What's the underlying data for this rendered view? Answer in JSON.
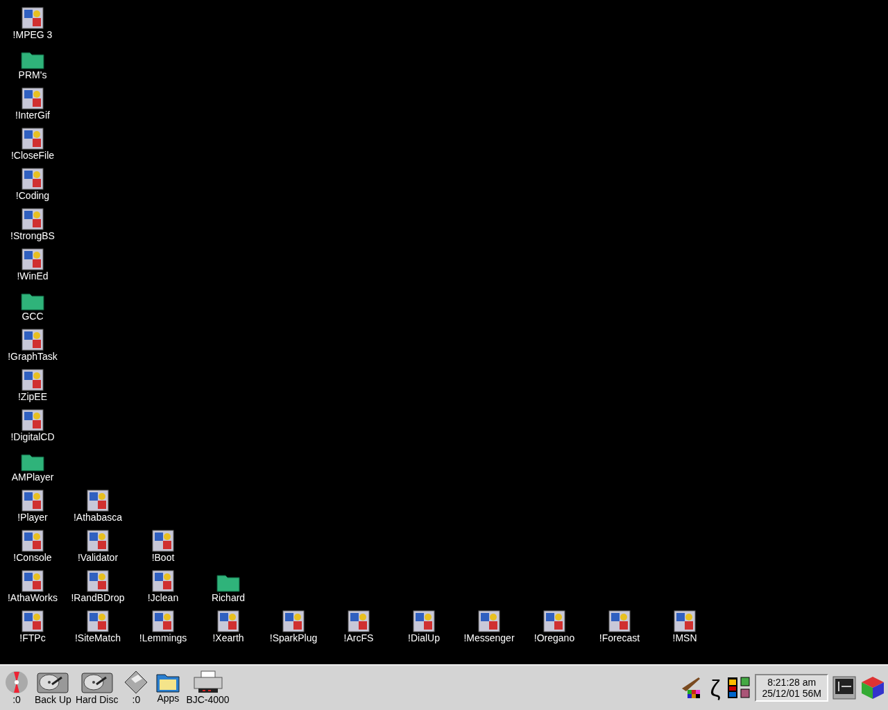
{
  "desktop": {
    "columns": [
      [
        {
          "label": "!MPEG 3",
          "kind": "app"
        },
        {
          "label": "PRM's",
          "kind": "folder"
        },
        {
          "label": "!InterGif",
          "kind": "app"
        },
        {
          "label": "!CloseFile",
          "kind": "app"
        },
        {
          "label": "!Coding",
          "kind": "app"
        },
        {
          "label": "!StrongBS",
          "kind": "app"
        },
        {
          "label": "!WinEd",
          "kind": "app"
        },
        {
          "label": "GCC",
          "kind": "folder"
        },
        {
          "label": "!GraphTask",
          "kind": "app"
        },
        {
          "label": "!ZipEE",
          "kind": "app"
        },
        {
          "label": "!DigitalCD",
          "kind": "app"
        },
        {
          "label": "AMPlayer",
          "kind": "folder"
        },
        {
          "label": "!Player",
          "kind": "app"
        },
        {
          "label": "!Console",
          "kind": "app"
        },
        {
          "label": "!AthaWorks",
          "kind": "app"
        },
        {
          "label": "!FTPc",
          "kind": "app"
        }
      ],
      [
        {
          "label": "!Athabasca",
          "kind": "app"
        },
        {
          "label": "!Validator",
          "kind": "app"
        },
        {
          "label": "!RandBDrop",
          "kind": "app"
        },
        {
          "label": "!SiteMatch",
          "kind": "app"
        }
      ],
      [
        {
          "label": "!Boot",
          "kind": "app"
        },
        {
          "label": "!Jclean",
          "kind": "app"
        },
        {
          "label": "!Lemmings",
          "kind": "app"
        }
      ],
      [
        {
          "label": "Richard",
          "kind": "folder"
        },
        {
          "label": "!Xearth",
          "kind": "app"
        }
      ],
      [
        {
          "label": "!SparkPlug",
          "kind": "app"
        }
      ],
      [
        {
          "label": "!ArcFS",
          "kind": "app"
        }
      ],
      [
        {
          "label": "!DialUp",
          "kind": "app"
        }
      ],
      [
        {
          "label": "!Messenger",
          "kind": "app"
        }
      ],
      [
        {
          "label": "!Oregano",
          "kind": "app"
        }
      ],
      [
        {
          "label": "!Forecast",
          "kind": "app"
        }
      ],
      [
        {
          "label": "!MSN",
          "kind": "app"
        }
      ]
    ]
  },
  "icon_bar": {
    "left": [
      {
        "label": ":0",
        "kind": "cd"
      },
      {
        "label": "Back Up",
        "kind": "harddisc"
      },
      {
        "label": "Hard Disc",
        "kind": "harddisc"
      },
      {
        "label": ":0",
        "kind": "floppy"
      },
      {
        "label": "Apps",
        "kind": "folder"
      },
      {
        "label": "BJC-4000",
        "kind": "printer"
      }
    ],
    "right": [
      {
        "kind": "paint"
      },
      {
        "kind": "glyph",
        "glyph": "ζ"
      },
      {
        "kind": "palette"
      },
      {
        "kind": "clock",
        "time": "8:21:28 am",
        "date": "25/12/01 56M"
      },
      {
        "kind": "display"
      },
      {
        "kind": "cube"
      }
    ]
  }
}
